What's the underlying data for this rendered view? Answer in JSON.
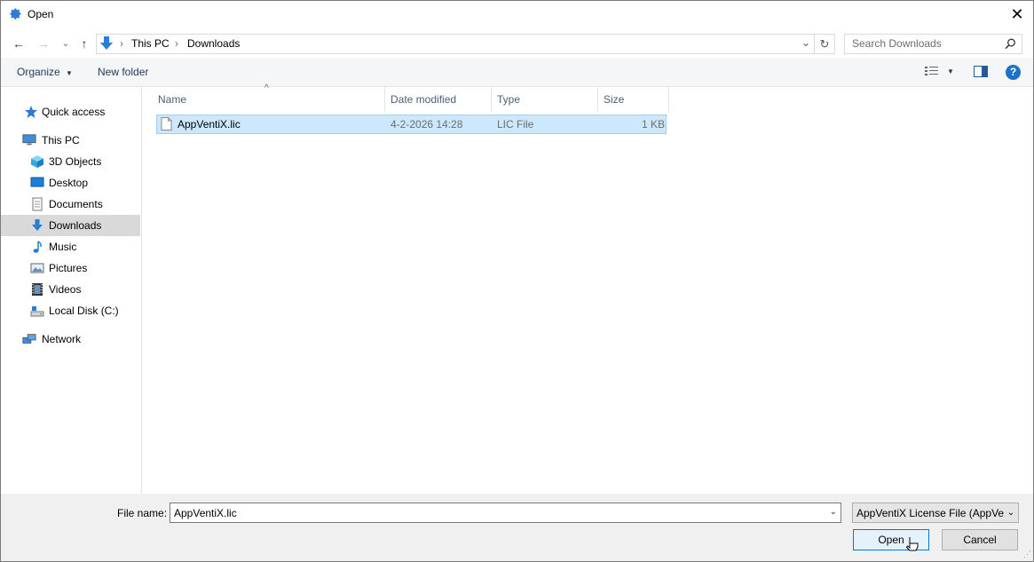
{
  "window": {
    "title": "Open",
    "close_glyph": "✕"
  },
  "nav": {
    "back_glyph": "←",
    "forward_glyph": "→",
    "recent_glyph": "⌄",
    "up_glyph": "↑",
    "breadcrumb": [
      "This PC",
      "Downloads"
    ],
    "separator": "›",
    "refresh_glyph": "↻",
    "search_placeholder": "Search Downloads"
  },
  "toolbar": {
    "organize_label": "Organize",
    "new_folder_label": "New folder",
    "help_glyph": "?"
  },
  "sidebar": {
    "items": [
      {
        "label": "Quick access",
        "icon": "star-icon"
      },
      {
        "label": "This PC",
        "icon": "computer-icon"
      },
      {
        "label": "3D Objects",
        "icon": "cube-icon"
      },
      {
        "label": "Desktop",
        "icon": "desktop-icon"
      },
      {
        "label": "Documents",
        "icon": "document-icon"
      },
      {
        "label": "Downloads",
        "icon": "download-icon",
        "selected": true
      },
      {
        "label": "Music",
        "icon": "music-icon"
      },
      {
        "label": "Pictures",
        "icon": "picture-icon"
      },
      {
        "label": "Videos",
        "icon": "video-icon"
      },
      {
        "label": "Local Disk (C:)",
        "icon": "disk-icon"
      },
      {
        "label": "Network",
        "icon": "network-icon"
      }
    ]
  },
  "filelist": {
    "columns": [
      "Name",
      "Date modified",
      "Type",
      "Size"
    ],
    "sort_glyph": "^",
    "rows": [
      {
        "name": "AppVentiX.lic",
        "date": "4-2-2026 14:28",
        "type": "LIC File",
        "size": "1 KB",
        "selected": true
      }
    ]
  },
  "footer": {
    "filename_label": "File name:",
    "filename_value": "AppVentiX.lic",
    "filter_value": "AppVentiX License File (AppVentiX.lic)",
    "dropdown_glyph": "⌄",
    "open_label": "Open",
    "cancel_label": "Cancel"
  },
  "colors": {
    "accent": "#0078d7",
    "selection": "#cce8ff",
    "selection_border": "#99d1ff",
    "sidebar_selected": "#d9d9d9"
  }
}
